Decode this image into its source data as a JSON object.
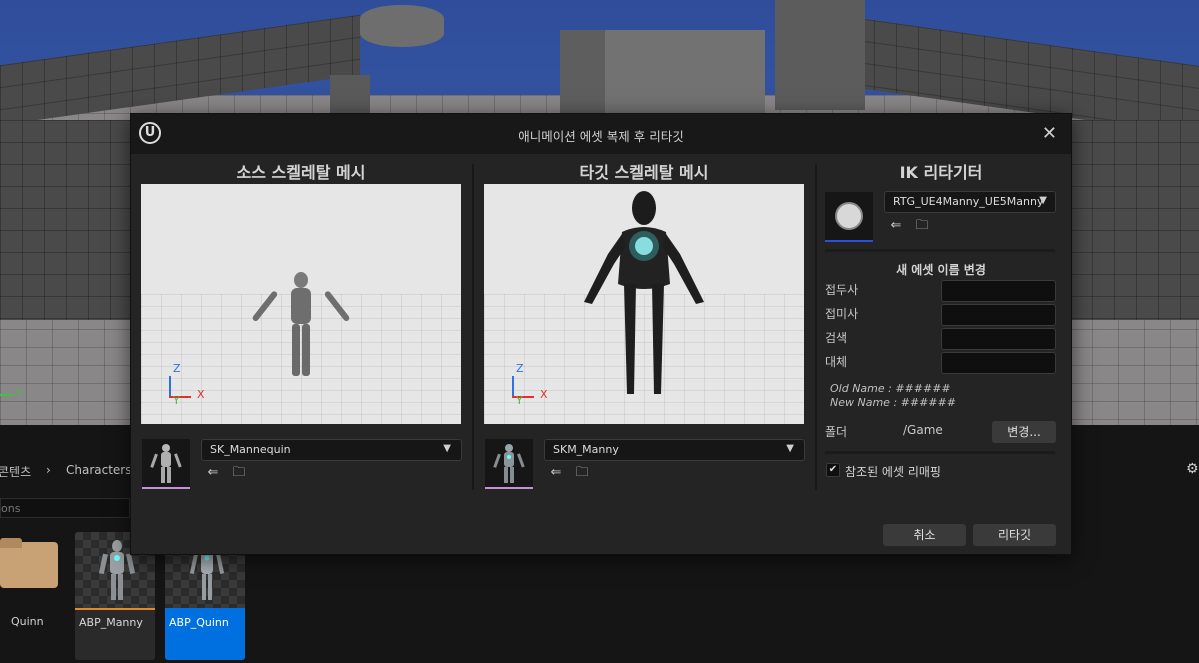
{
  "dialog": {
    "title": "애니메이션 에셋 복제 후 리타깃",
    "source": {
      "heading": "소스 스켈레탈 메시",
      "mesh_value": "SK_Mannequin"
    },
    "target": {
      "heading": "타깃 스켈레탈 메시",
      "mesh_value": "SKM_Manny"
    },
    "ik": {
      "heading": "IK 리타기터",
      "retargeter_value": "RTG_UE4Manny_UE5Manny",
      "rename_heading": "새 에셋 이름 변경",
      "prefix_label": "접두사",
      "suffix_label": "접미사",
      "search_label": "검색",
      "replace_label": "대체",
      "old_name": "Old Name : ######",
      "new_name": "New Name : ######",
      "folder_label": "폴더",
      "folder_value": "/Game",
      "change_button": "변경...",
      "remap_label": "참조된 에셋 리매핑",
      "remap_checked": true
    },
    "cancel_button": "취소",
    "retarget_button": "리타깃",
    "axis_z": "Z",
    "axis_y": "Y",
    "axis_x": "X"
  },
  "content_browser": {
    "breadcrumb_root": "콘텐츠",
    "breadcrumb_folder": "Characters",
    "filter_placeholder": "ons",
    "assets": [
      {
        "name": "Quinn"
      },
      {
        "name": "ABP_Manny"
      },
      {
        "name": "ABP_Quinn"
      }
    ]
  },
  "viewport": {
    "axis_y": "Y"
  },
  "colors": {
    "accent_blue": "#0070e0",
    "axis_x": "#e03030",
    "axis_y": "#40c040",
    "axis_z": "#3070e0",
    "thumb_underline": "#c88fd8"
  }
}
